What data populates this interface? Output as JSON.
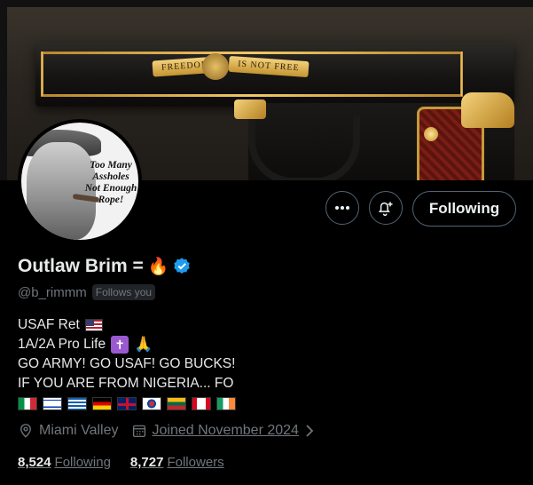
{
  "banner": {
    "ribbon_left": "FREEDOM",
    "ribbon_right": "IS NOT FREE"
  },
  "avatar": {
    "text_line1": "Too Many",
    "text_line2": "Assholes",
    "text_line3": "Not Enough",
    "text_line4": "Rope!"
  },
  "actions": {
    "more_icon": "more-icon",
    "notify_icon": "notification-bell-icon",
    "follow_label": "Following"
  },
  "profile": {
    "display_name": "Outlaw Brim =",
    "name_emoji": "🔥",
    "verified": true,
    "verified_color": "#1d9bf0",
    "handle": "@b_rimmm",
    "follows_you": "Follows you"
  },
  "bio": {
    "line1": "USAF Ret",
    "line2": "1A/2A Pro Life",
    "line3": "GO ARMY! GO USAF! GO BUCKS!",
    "line4": "IF YOU ARE FROM NIGERIA... FO",
    "flags": [
      "Italy",
      "Israel",
      "Greece",
      "Germany",
      "United Kingdom",
      "South Korea",
      "Lithuania",
      "Canada",
      "Ireland"
    ]
  },
  "meta": {
    "location": "Miami Valley",
    "joined": "Joined November 2024"
  },
  "counts": {
    "following_num": "8,524",
    "following_label": "Following",
    "followers_num": "8,727",
    "followers_label": "Followers"
  }
}
